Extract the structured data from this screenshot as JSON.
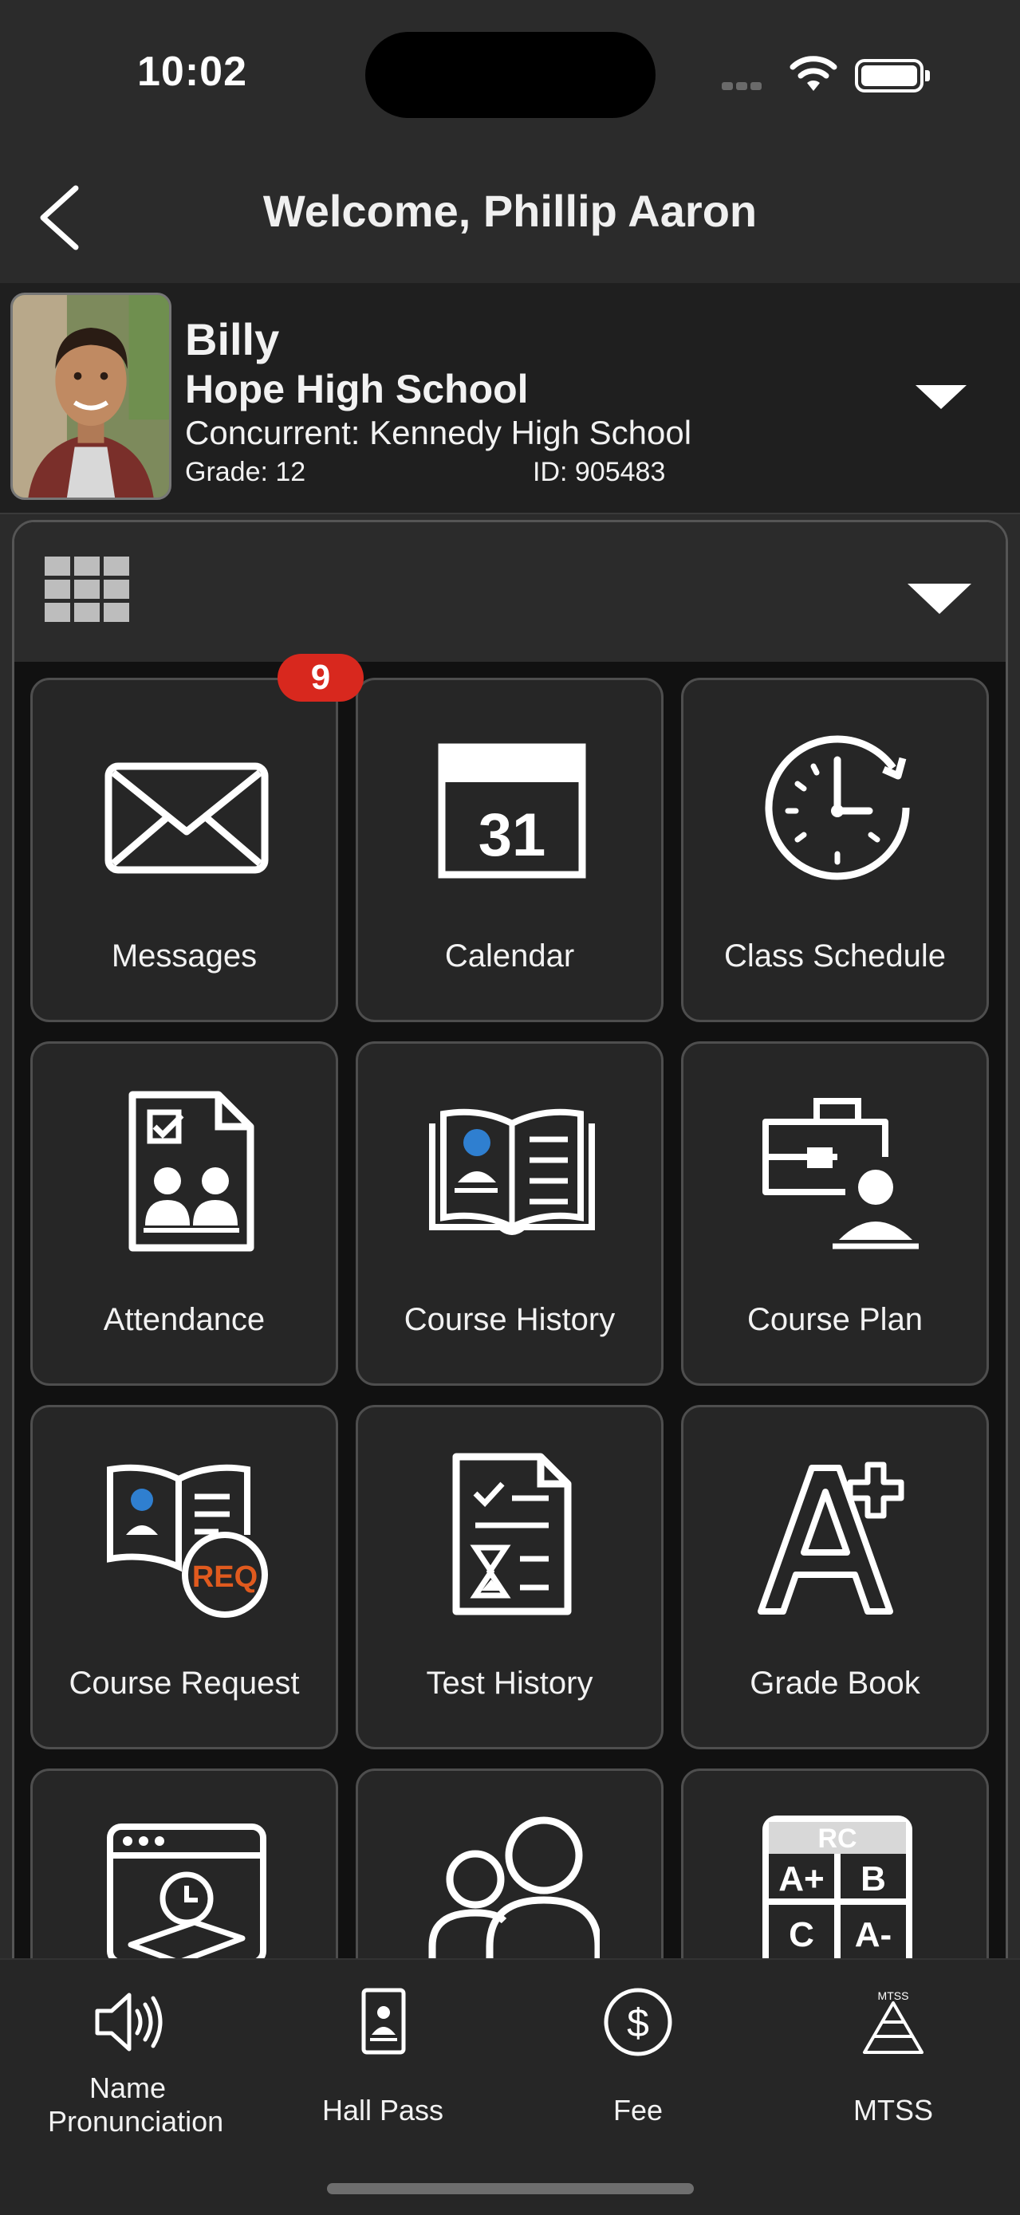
{
  "status_bar": {
    "time": "10:02"
  },
  "header": {
    "back_icon": "chevron-left-icon",
    "title": "Welcome, Phillip Aaron"
  },
  "student": {
    "name": "Billy",
    "school": "Hope High School",
    "concurrent": "Concurrent: Kennedy High School",
    "grade": "Grade: 12",
    "id": "ID: 905483"
  },
  "tiles": [
    {
      "label": "Messages",
      "icon": "envelope-icon",
      "badge": "9"
    },
    {
      "label": "Calendar",
      "icon": "calendar-icon",
      "calendar_day": "31"
    },
    {
      "label": "Class Schedule",
      "icon": "clock-icon"
    },
    {
      "label": "Attendance",
      "icon": "attendance-icon"
    },
    {
      "label": "Course History",
      "icon": "open-book-icon"
    },
    {
      "label": "Course Plan",
      "icon": "briefcase-student-icon"
    },
    {
      "label": "Course Request",
      "icon": "book-req-icon",
      "icon_text": "REQ"
    },
    {
      "label": "Test History",
      "icon": "test-hourglass-icon"
    },
    {
      "label": "Grade Book",
      "icon": "a-plus-icon"
    },
    {
      "label": "",
      "icon": "online-clock-book-icon"
    },
    {
      "label": "",
      "icon": "people-icon"
    },
    {
      "label": "",
      "icon": "report-card-icon",
      "icon_text": [
        "RC",
        "A+",
        "B",
        "C",
        "A-"
      ]
    }
  ],
  "tab_bar": [
    {
      "label": "Name Pronunciation",
      "icon": "speaker-icon"
    },
    {
      "label": "Hall Pass",
      "icon": "hall-pass-icon"
    },
    {
      "label": "Fee",
      "icon": "dollar-circle-icon"
    },
    {
      "label": "MTSS",
      "icon": "pyramid-icon",
      "icon_text": "MTSS"
    }
  ],
  "colors": {
    "background": "#2b2b2b",
    "panel": "#111111",
    "tile": "#262626",
    "badge": "#d8281e",
    "accent_blue": "#2f7fd0",
    "accent_orange": "#e05a1e"
  }
}
